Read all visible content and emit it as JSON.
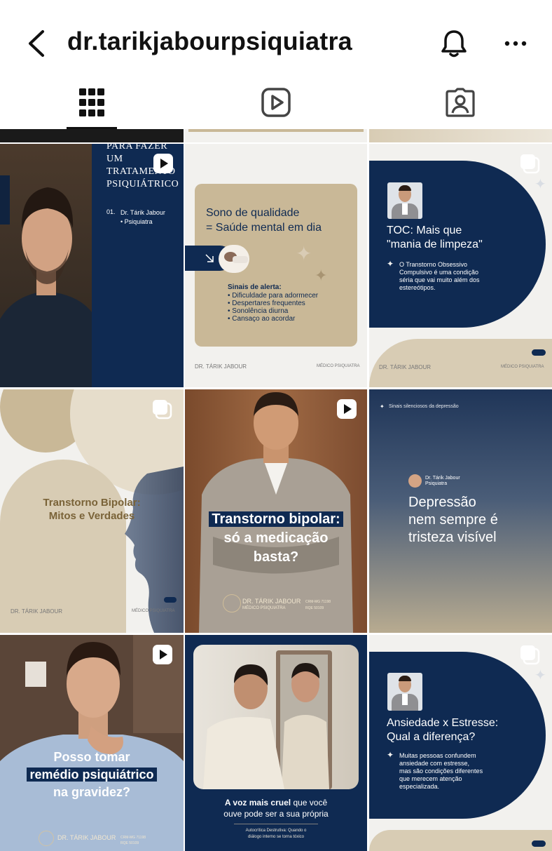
{
  "header": {
    "username": "dr.tarikjabourpsiquiatra",
    "icons": [
      "back-arrow-icon",
      "bell-icon",
      "more-options-icon"
    ]
  },
  "tabs": [
    {
      "name": "posts-grid",
      "icon": "grid-icon",
      "active": true
    },
    {
      "name": "reels",
      "icon": "reels-icon",
      "active": false
    },
    {
      "name": "tagged",
      "icon": "tagged-person-icon",
      "active": false
    }
  ],
  "posts": {
    "p1": {
      "heading_lines": [
        "PARA FAZER",
        "UM",
        "TRATAMENTO",
        "PSIQUIÁTRICO"
      ],
      "number": "01.",
      "author": "Dr. Tárik Jabour",
      "role": "• Psiquiatra",
      "type": "reel"
    },
    "p2": {
      "title_line1": "Sono de qualidade",
      "title_line2": "= Saúde mental em dia",
      "alert_title": "Sinais de alerta:",
      "alerts": [
        "• Dificuldade para adormecer",
        "• Despertares frequentes",
        "• Sonolência diurna",
        "• Cansaço ao acordar"
      ],
      "footer_left": "DR. TÁRIK JABOUR",
      "footer_right": "MÉDICO PSIQUIATRA"
    },
    "p3": {
      "title_line1": "TOC: Mais que",
      "title_line2": "\"mania de limpeza\"",
      "body_lines": [
        "O Transtorno Obsessivo",
        "Compulsivo é uma condição",
        "séria que vai muito além dos",
        "estereótipos."
      ],
      "footer_left": "DR. TÁRIK JABOUR",
      "footer_right": "MÉDICO PSIQUIATRA",
      "type": "carousel"
    },
    "p4": {
      "title_line1": "Transtorno Bipolar:",
      "title_line2": "Mitos e Verdades",
      "footer_left": "DR. TÁRIK JABOUR",
      "footer_right": "MÉDICO PSIQUIATRA",
      "type": "carousel"
    },
    "p5": {
      "lines": [
        "Transtorno bipolar:",
        "só a medicação",
        "basta?"
      ],
      "brand": "DR. TÁRIK JABOUR",
      "brand_sub": "MÉDICO PSIQUIATRA",
      "crm": "CRM-MG 71198",
      "rqe": "RQE 50109",
      "type": "reel"
    },
    "p6": {
      "topline": "Sinais silenciosos da depressão",
      "author": "Dr. Tárik Jabour",
      "role": "Psiquiatra",
      "lines": [
        "Depressão",
        "nem sempre é",
        "tristeza visível"
      ]
    },
    "p7": {
      "lines": [
        "Posso tomar",
        "remédio psiquiátrico",
        "na gravidez?"
      ],
      "brand": "DR. TÁRIK JABOUR",
      "crm": "CRM-MG 71198",
      "rqe": "RQE 50109",
      "type": "reel"
    },
    "p8": {
      "quote_bold": "A voz mais cruel",
      "quote_rest": " que você",
      "quote_line2": "ouve pode ser a sua própria",
      "sub_line1": "Autocrítica Destrutiva: Quando o",
      "sub_line2": "diálogo interno se torna tóxico"
    },
    "p9": {
      "title_line1": "Ansiedade x Estresse:",
      "title_line2": "Qual a diferença?",
      "body_lines": [
        "Muitas pessoas confundem",
        "ansiedade com estresse,",
        "mas são condições diferentes",
        "que merecem atenção",
        "especializada."
      ],
      "type": "carousel"
    }
  },
  "colors": {
    "navy": "#0f2a52",
    "beige": "#c9b897",
    "light": "#f2f1ee",
    "brown": "#8b5a3a"
  }
}
